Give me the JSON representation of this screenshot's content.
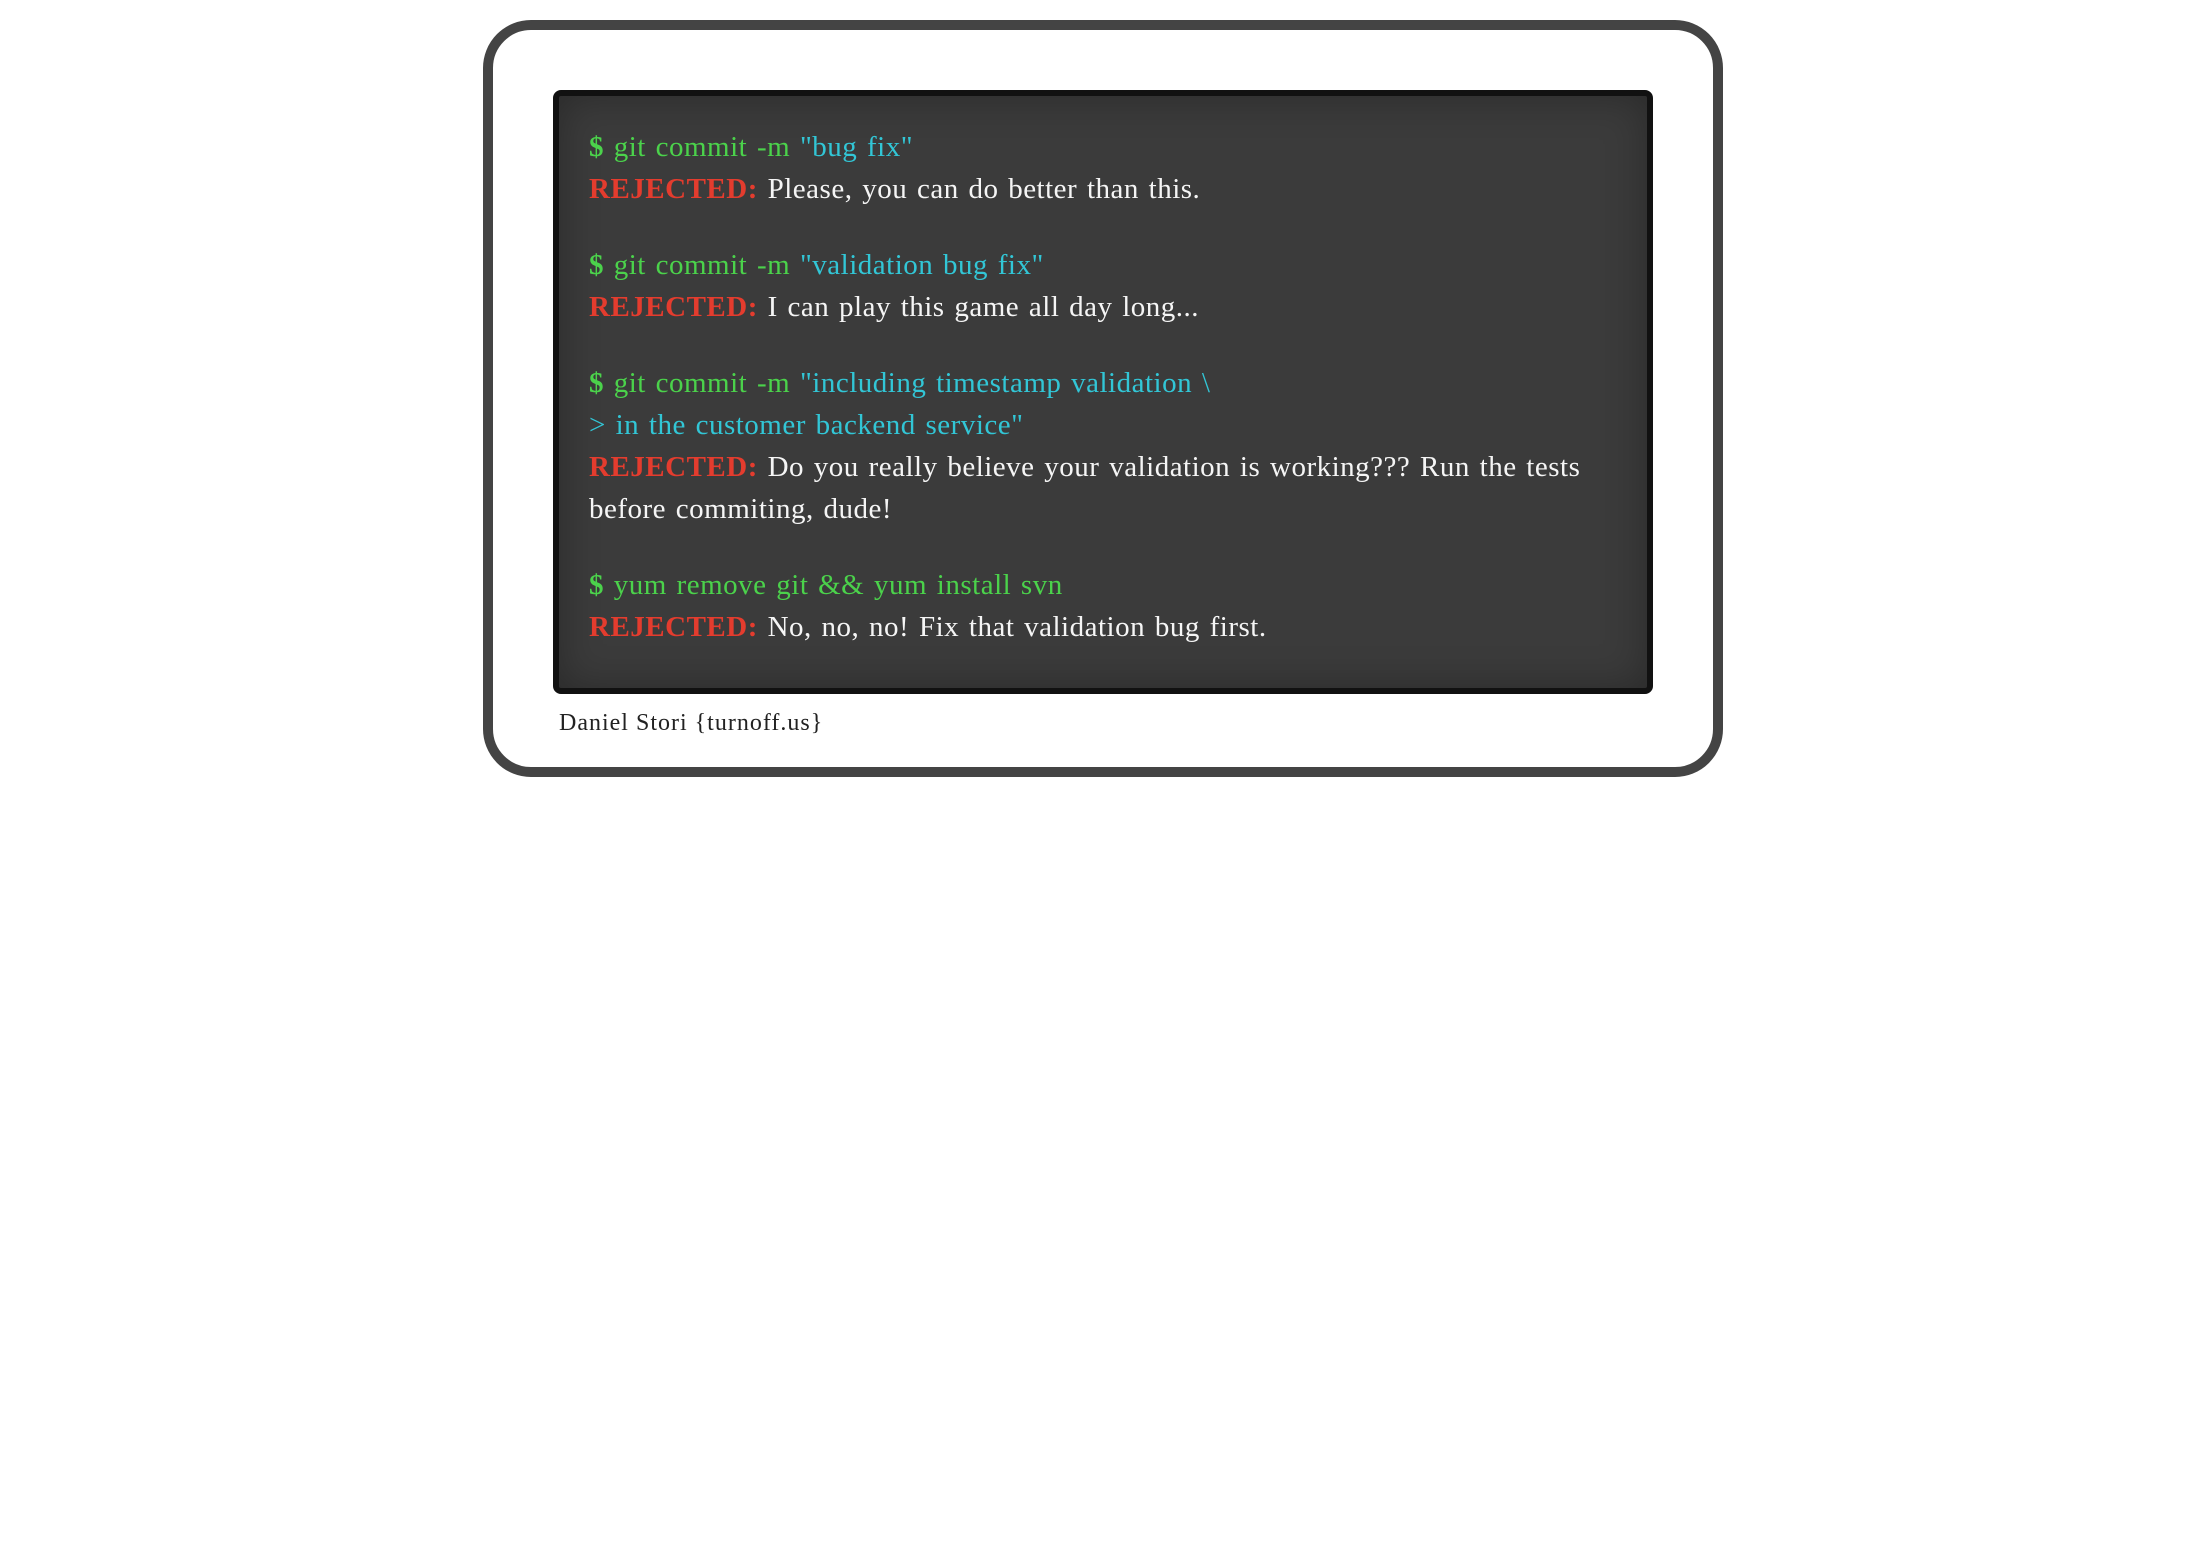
{
  "colors": {
    "prompt_green": "#4bd24b",
    "message_cyan": "#32c6d6",
    "rejected_red": "#e43c2e",
    "output_white": "#f5f5f5",
    "chalkboard_bg": "#3b3b3b",
    "card_border": "#444444"
  },
  "blocks": [
    {
      "prompt": "$",
      "command": "git commit -m",
      "message": "\"bug fix\"",
      "continuation_prompt": "",
      "continuation": "",
      "rejected_label": "REJECTED:",
      "output": "Please, you can do better than this."
    },
    {
      "prompt": "$",
      "command": "git commit -m",
      "message": "\"validation bug fix\"",
      "continuation_prompt": "",
      "continuation": "",
      "rejected_label": "REJECTED:",
      "output": "I can play this game all day long..."
    },
    {
      "prompt": "$",
      "command": "git commit -m",
      "message": "\"including timestamp validation \\",
      "continuation_prompt": ">",
      "continuation": "in the customer backend service\"",
      "rejected_label": "REJECTED:",
      "output": "Do you really believe your validation is working??? Run the tests before commiting, dude!"
    },
    {
      "prompt": "$",
      "command": "yum remove git && yum install svn",
      "message": "",
      "continuation_prompt": "",
      "continuation": "",
      "rejected_label": "REJECTED:",
      "output": "No, no, no! Fix that validation bug first."
    }
  ],
  "credit": "Daniel Stori {turnoff.us}"
}
